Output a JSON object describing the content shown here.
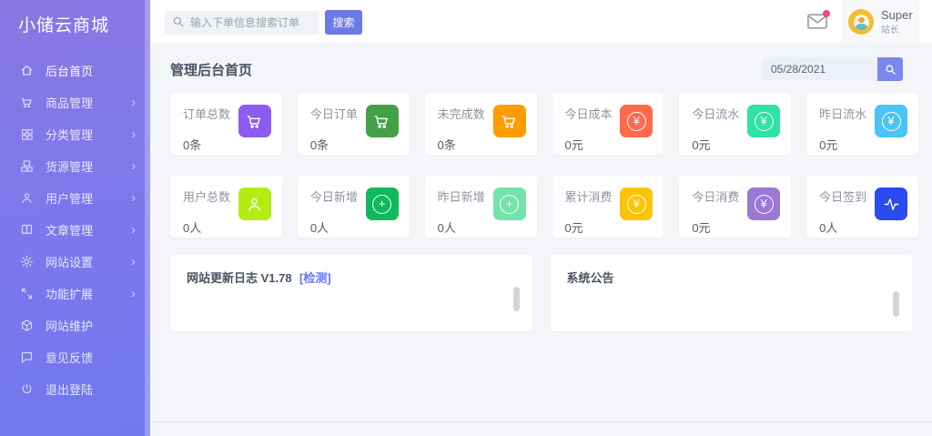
{
  "app": {
    "title": "小储云商城"
  },
  "sidebar": {
    "items": [
      {
        "label": "后台首页"
      },
      {
        "label": "商品管理"
      },
      {
        "label": "分类管理"
      },
      {
        "label": "货源管理"
      },
      {
        "label": "用户管理"
      },
      {
        "label": "文章管理"
      },
      {
        "label": "网站设置"
      },
      {
        "label": "功能扩展"
      },
      {
        "label": "网站维护"
      },
      {
        "label": "意见反馈"
      },
      {
        "label": "退出登陆"
      }
    ]
  },
  "header": {
    "search_placeholder": "输入下单信息搜索订单",
    "search_button": "搜索",
    "user": {
      "name": "Super",
      "role": "站长"
    }
  },
  "page": {
    "title": "管理后台首页",
    "date_value": "05/28/2021"
  },
  "stats": {
    "cards": [
      {
        "label": "订单总数",
        "value": "0条",
        "icon": "cart-icon",
        "color": "#8d5bf0"
      },
      {
        "label": "今日订单",
        "value": "0条",
        "icon": "cart-icon",
        "color": "#43a047"
      },
      {
        "label": "未完成数",
        "value": "0条",
        "icon": "cart-icon",
        "color": "#ff9d00"
      },
      {
        "label": "今日成本",
        "value": "0元",
        "icon": "yen-icon",
        "color": "#ff6a4b"
      },
      {
        "label": "今日流水",
        "value": "0元",
        "icon": "yen-icon",
        "color": "#2fe2a6"
      },
      {
        "label": "昨日流水",
        "value": "0元",
        "icon": "yen-icon",
        "color": "#4cc3f7"
      },
      {
        "label": "用户总数",
        "value": "0人",
        "icon": "person-icon",
        "color": "#b2ec13"
      },
      {
        "label": "今日新增",
        "value": "0人",
        "icon": "plus-icon",
        "color": "#0fb95c"
      },
      {
        "label": "昨日新增",
        "value": "0人",
        "icon": "plus-icon",
        "color": "#74e3aa"
      },
      {
        "label": "累计消费",
        "value": "0元",
        "icon": "yen-icon",
        "color": "#fcc408"
      },
      {
        "label": "今日消费",
        "value": "0元",
        "icon": "yen-icon",
        "color": "#9b78d4"
      },
      {
        "label": "今日签到",
        "value": "0人",
        "icon": "pulse-icon",
        "color": "#2a4bf0"
      }
    ]
  },
  "panels": {
    "changelog": {
      "title": "网站更新日志 V1.78",
      "link": "[检测]"
    },
    "announcement": {
      "title": "系统公告"
    }
  },
  "colors": {
    "accent": "#6c7ae8",
    "sidebar_top": "#8b76e2",
    "sidebar_bottom": "#7078f0"
  }
}
